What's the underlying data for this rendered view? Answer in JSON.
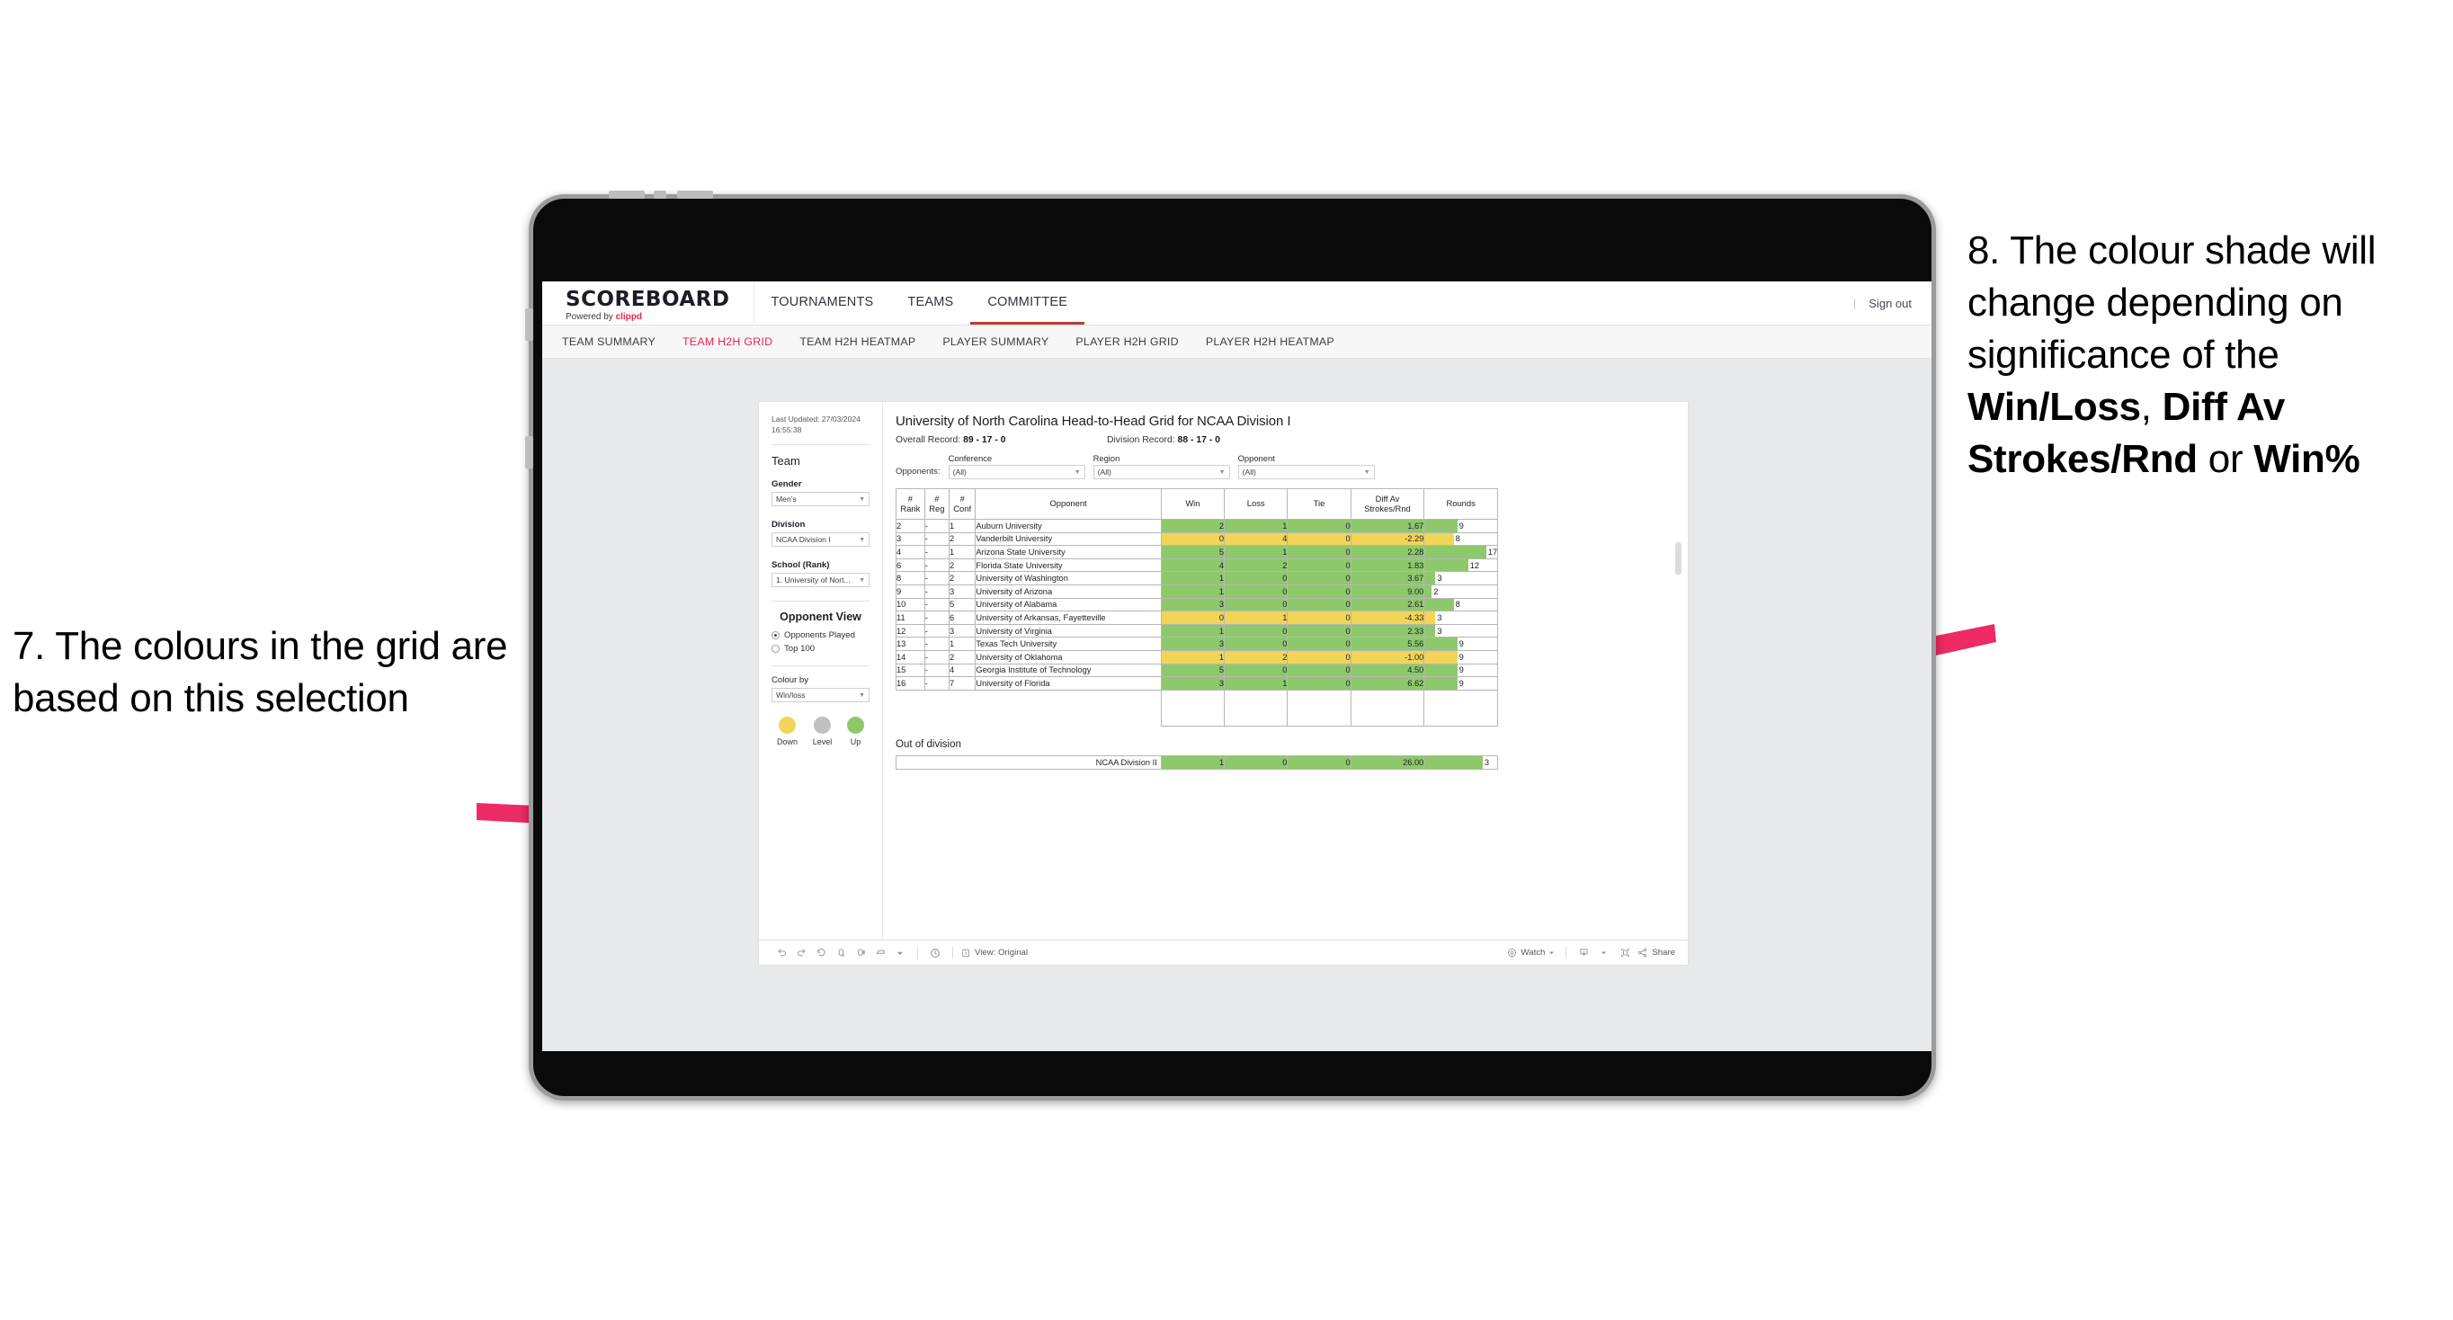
{
  "annotations": {
    "left": {
      "text": "7. The colours in the grid are based on this selection"
    },
    "right": {
      "prefix": "8. The colour shade will change depending on significance of the ",
      "bold1": "Win/Loss",
      "mid1": ", ",
      "bold2": "Diff Av Strokes/Rnd",
      "mid2": " or ",
      "bold3": "Win%"
    },
    "arrow_color": "#ED2A63"
  },
  "app": {
    "logo": {
      "main": "SCOREBOARD",
      "sub_prefix": "Powered by ",
      "brand": "clippd"
    },
    "nav": [
      {
        "label": "TOURNAMENTS",
        "active": false
      },
      {
        "label": "TEAMS",
        "active": false
      },
      {
        "label": "COMMITTEE",
        "active": true
      }
    ],
    "signout": "Sign out",
    "divider": "|",
    "subnav": [
      {
        "label": "TEAM SUMMARY",
        "active": false
      },
      {
        "label": "TEAM H2H GRID",
        "active": true
      },
      {
        "label": "TEAM H2H HEATMAP",
        "active": false
      },
      {
        "label": "PLAYER SUMMARY",
        "active": false
      },
      {
        "label": "PLAYER H2H GRID",
        "active": false
      },
      {
        "label": "PLAYER H2H HEATMAP",
        "active": false
      }
    ]
  },
  "sidebar": {
    "last_updated": "Last Updated: 27/03/2024 16:55:38",
    "team_heading": "Team",
    "gender": {
      "label": "Gender",
      "value": "Men's"
    },
    "division": {
      "label": "Division",
      "value": "NCAA Division I"
    },
    "school": {
      "label": "School (Rank)",
      "value": "1. University of Nort..."
    },
    "opponent_view": {
      "heading": "Opponent View",
      "options": [
        {
          "label": "Opponents Played",
          "selected": true
        },
        {
          "label": "Top 100",
          "selected": false
        }
      ]
    },
    "colour_by": {
      "label": "Colour by",
      "value": "Win/loss"
    },
    "legend": [
      {
        "label": "Down",
        "color": "#F2D458"
      },
      {
        "label": "Level",
        "color": "#BFBFC4"
      },
      {
        "label": "Up",
        "color": "#8DC96B"
      }
    ]
  },
  "viz": {
    "title": "University of North Carolina Head-to-Head Grid for NCAA Division I",
    "overall_record_label": "Overall Record:",
    "overall_record_value": "89 - 17 - 0",
    "division_record_label": "Division Record:",
    "division_record_value": "88 - 17 - 0",
    "opponents_label": "Opponents:",
    "filters": [
      {
        "label": "Conference",
        "value": "(All)"
      },
      {
        "label": "Region",
        "value": "(All)"
      },
      {
        "label": "Opponent",
        "value": "(All)"
      }
    ],
    "columns": [
      "# Rank",
      "# Reg",
      "# Conf",
      "Opponent",
      "Win",
      "Loss",
      "Tie",
      "Diff Av Strokes/Rnd",
      "Rounds"
    ],
    "columns_split": [
      {
        "l1": "#",
        "l2": "Rank"
      },
      {
        "l1": "#",
        "l2": "Reg"
      },
      {
        "l1": "#",
        "l2": "Conf"
      },
      {
        "l1": "Opponent",
        "l2": ""
      },
      {
        "l1": "Win",
        "l2": ""
      },
      {
        "l1": "Loss",
        "l2": ""
      },
      {
        "l1": "Tie",
        "l2": ""
      },
      {
        "l1": "Diff Av",
        "l2": "Strokes/Rnd"
      },
      {
        "l1": "Rounds",
        "l2": ""
      }
    ],
    "rows": [
      {
        "rank": "2",
        "reg": "-",
        "conf": "1",
        "opponent": "Auburn University",
        "win": "2",
        "loss": "1",
        "tie": "0",
        "diff": "1.67",
        "rounds": "9",
        "state": "up",
        "bar_pct": 45
      },
      {
        "rank": "3",
        "reg": "-",
        "conf": "2",
        "opponent": "Vanderbilt University",
        "win": "0",
        "loss": "4",
        "tie": "0",
        "diff": "-2.29",
        "rounds": "8",
        "state": "down",
        "bar_pct": 40
      },
      {
        "rank": "4",
        "reg": "-",
        "conf": "1",
        "opponent": "Arizona State University",
        "win": "5",
        "loss": "1",
        "tie": "0",
        "diff": "2.28",
        "rounds": "17",
        "state": "up",
        "bar_pct": 85
      },
      {
        "rank": "6",
        "reg": "-",
        "conf": "2",
        "opponent": "Florida State University",
        "win": "4",
        "loss": "2",
        "tie": "0",
        "diff": "1.83",
        "rounds": "12",
        "state": "up",
        "bar_pct": 60
      },
      {
        "rank": "8",
        "reg": "-",
        "conf": "2",
        "opponent": "University of Washington",
        "win": "1",
        "loss": "0",
        "tie": "0",
        "diff": "3.67",
        "rounds": "3",
        "state": "up",
        "bar_pct": 15
      },
      {
        "rank": "9",
        "reg": "-",
        "conf": "3",
        "opponent": "University of Arizona",
        "win": "1",
        "loss": "0",
        "tie": "0",
        "diff": "9.00",
        "rounds": "2",
        "state": "up",
        "bar_pct": 10
      },
      {
        "rank": "10",
        "reg": "-",
        "conf": "5",
        "opponent": "University of Alabama",
        "win": "3",
        "loss": "0",
        "tie": "0",
        "diff": "2.61",
        "rounds": "8",
        "state": "up",
        "bar_pct": 40
      },
      {
        "rank": "11",
        "reg": "-",
        "conf": "6",
        "opponent": "University of Arkansas, Fayetteville",
        "win": "0",
        "loss": "1",
        "tie": "0",
        "diff": "-4.33",
        "rounds": "3",
        "state": "down",
        "bar_pct": 15
      },
      {
        "rank": "12",
        "reg": "-",
        "conf": "3",
        "opponent": "University of Virginia",
        "win": "1",
        "loss": "0",
        "tie": "0",
        "diff": "2.33",
        "rounds": "3",
        "state": "up",
        "bar_pct": 15
      },
      {
        "rank": "13",
        "reg": "-",
        "conf": "1",
        "opponent": "Texas Tech University",
        "win": "3",
        "loss": "0",
        "tie": "0",
        "diff": "5.56",
        "rounds": "9",
        "state": "up",
        "bar_pct": 45
      },
      {
        "rank": "14",
        "reg": "-",
        "conf": "2",
        "opponent": "University of Oklahoma",
        "win": "1",
        "loss": "2",
        "tie": "0",
        "diff": "-1.00",
        "rounds": "9",
        "state": "down",
        "bar_pct": 45
      },
      {
        "rank": "15",
        "reg": "-",
        "conf": "4",
        "opponent": "Georgia Institute of Technology",
        "win": "5",
        "loss": "0",
        "tie": "0",
        "diff": "4.50",
        "rounds": "9",
        "state": "up",
        "bar_pct": 45
      },
      {
        "rank": "16",
        "reg": "-",
        "conf": "7",
        "opponent": "University of Florida",
        "win": "3",
        "loss": "1",
        "tie": "0",
        "diff": "6.62",
        "rounds": "9",
        "state": "up",
        "bar_pct": 45
      }
    ],
    "out_of_division": {
      "title": "Out of division",
      "row": {
        "label": "NCAA Division II",
        "win": "1",
        "loss": "0",
        "tie": "0",
        "diff": "26.00",
        "rounds": "3",
        "state": "up",
        "bar_pct": 80
      }
    },
    "colors": {
      "up": "#8DC96B",
      "down": "#F2D458",
      "level": "#BFBFC4"
    }
  },
  "toolbar": {
    "view_label": "View: Original",
    "watch_label": "Watch",
    "share_label": "Share",
    "icons": [
      "undo-icon",
      "redo-icon",
      "revert-icon",
      "refresh-icon",
      "pause-icon",
      "dashboard-icon",
      "chevron-down-icon",
      "alert-icon",
      "info-icon",
      "eye-icon",
      "watch-chevron-icon",
      "download-icon",
      "download-chevron-icon",
      "fullscreen-icon",
      "share-icon"
    ]
  }
}
